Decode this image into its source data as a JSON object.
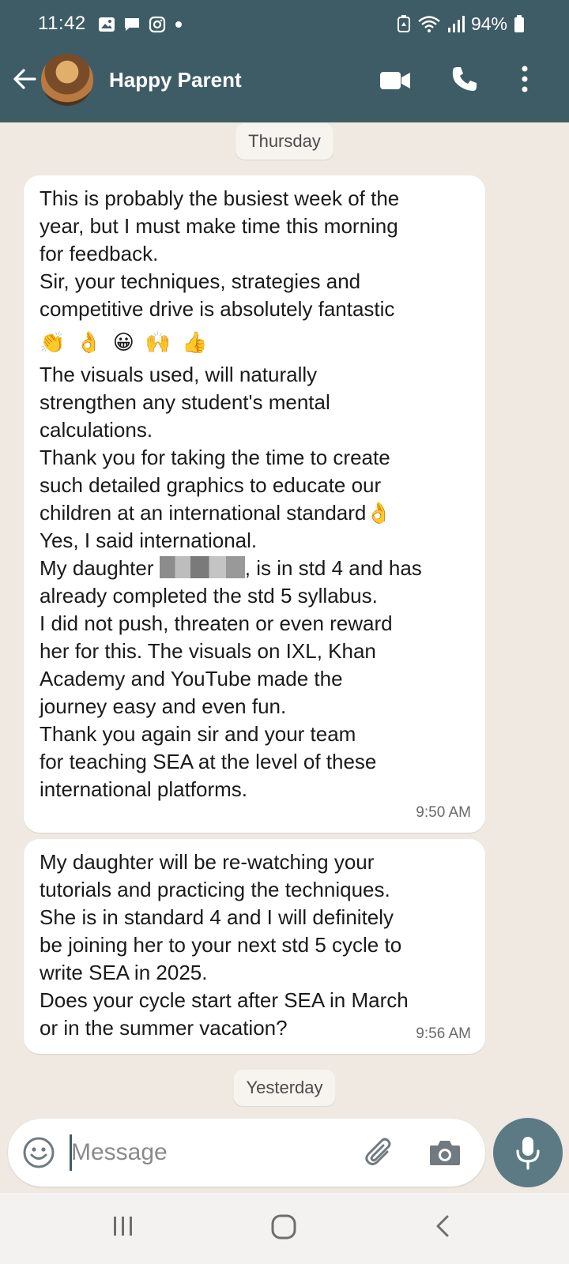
{
  "status_bar": {
    "time": "11:42",
    "battery": "94%",
    "left_icons": [
      "gallery-icon",
      "message-icon",
      "instagram-icon",
      "dot-icon"
    ],
    "right_icons": [
      "battery-saver-icon",
      "wifi-icon",
      "signal-icon",
      "battery-icon"
    ]
  },
  "header": {
    "contact_name": "Happy Parent",
    "icons": [
      "back-arrow-icon",
      "video-call-icon",
      "phone-icon",
      "more-icon"
    ]
  },
  "date_chips": {
    "first": "Thursday",
    "second": "Yesterday"
  },
  "messages": [
    {
      "lines": [
        "This is probably the busiest week of the",
        "year, but I must make time this morning",
        "for feedback.",
        "Sir, your techniques, strategies and",
        "competitive drive is absolutely fantastic",
        "The visuals used, will naturally",
        "strengthen any student's mental",
        "calculations.",
        "Thank you for taking the time to create",
        "such detailed graphics to educate our",
        "children at an international standard",
        "Yes, I said international.",
        "My daughter",
        ", is in std 4 and has",
        "already completed the std 5 syllabus.",
        "I did not push, threaten or even reward",
        "her for this. The visuals on IXL, Khan",
        "Academy and YouTube  made the",
        "journey easy and even fun.",
        "Thank you again sir and your team",
        "for teaching SEA at the level of these",
        "international platforms."
      ],
      "emojis": [
        "👏",
        "👌",
        "😀",
        "🙌",
        "👍"
      ],
      "inline_emoji": "👌",
      "time": "9:50 AM"
    },
    {
      "lines": [
        "My daughter will be re-watching your",
        "tutorials and practicing the techniques.",
        "She is in standard 4 and I will definitely",
        "be joining her  to your next std 5 cycle  to",
        "write SEA in 2025.",
        "Does your cycle start after SEA in March",
        "or in the summer vacation?"
      ],
      "time": "9:56 AM"
    }
  ],
  "composer": {
    "placeholder": "Message",
    "icons": [
      "emoji-icon",
      "attach-icon",
      "camera-icon",
      "mic-icon"
    ]
  },
  "navbar": {
    "icons": [
      "recents-icon",
      "home-icon",
      "back-icon"
    ]
  },
  "colors": {
    "header": "#3e5c66",
    "background": "#efe9e1",
    "bubble": "#ffffff",
    "mic": "#5c7a84"
  }
}
